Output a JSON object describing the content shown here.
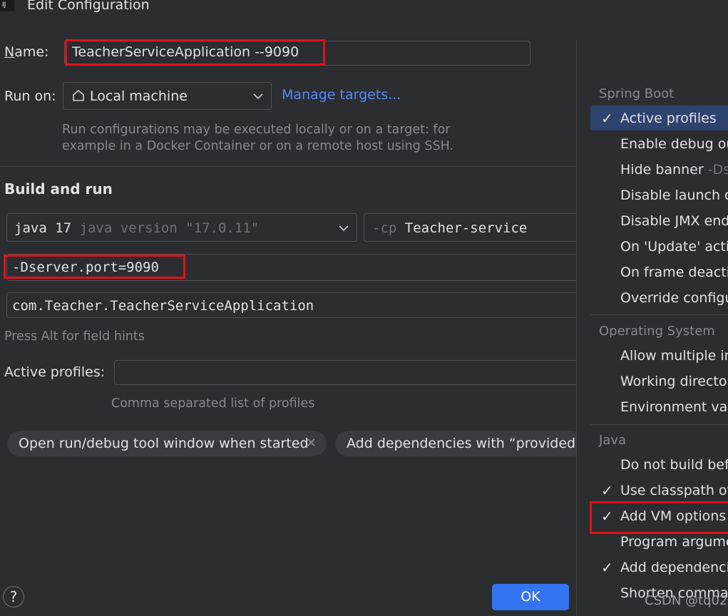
{
  "window": {
    "title": "Edit Configuration"
  },
  "name": {
    "label": "Name:",
    "value": "TeacherServiceApplication --9090"
  },
  "run_on": {
    "label": "Run on:",
    "value": "Local machine",
    "manage_link": "Manage targets...",
    "hint_line1": "Run configurations may be executed locally or on a target: for",
    "hint_line2": "example in a Docker Container or on a remote host using SSH."
  },
  "build": {
    "section_title": "Build and run",
    "jdk_value": "java 17",
    "jdk_version": "java version \"17.0.11\"",
    "cp_prefix": "-cp",
    "cp_value": "Teacher-service",
    "vm_options": "-Dserver.port=9090",
    "main_class": "com.Teacher.TeacherServiceApplication",
    "field_hints": "Press Alt for field hints"
  },
  "profiles": {
    "label": "Active profiles:",
    "value": "",
    "hint": "Comma separated list of profiles"
  },
  "chips": [
    {
      "label": "Open run/debug tool window when started"
    },
    {
      "label": "Add dependencies with “provided”"
    }
  ],
  "popup": {
    "groups": [
      {
        "title": "Spring Boot"
      },
      {
        "title": "Operating System"
      },
      {
        "title": "Java"
      }
    ],
    "items": [
      {
        "label": "Active profiles",
        "checked": true,
        "selected": true
      },
      {
        "label": "Enable debug ou",
        "checked": false
      },
      {
        "label": "Hide banner",
        "suffix": "-Ds",
        "checked": false
      },
      {
        "label": "Disable launch o",
        "checked": false
      },
      {
        "label": "Disable JMX end",
        "checked": false
      },
      {
        "label": "On 'Update' actio",
        "checked": false
      },
      {
        "label": "On frame deactiv",
        "checked": false
      },
      {
        "label": "Override configu",
        "checked": false
      },
      {
        "label": "Allow multiple in",
        "checked": false
      },
      {
        "label": "Working director",
        "checked": false
      },
      {
        "label": "Environment vari",
        "checked": false
      },
      {
        "label": "Do not build befo",
        "checked": false
      },
      {
        "label": "Use classpath of",
        "checked": true
      },
      {
        "label": "Add VM options",
        "checked": true
      },
      {
        "label": "Program argume",
        "checked": false
      },
      {
        "label": "Add dependencie",
        "checked": true
      },
      {
        "label": "Shorten comman",
        "checked": false
      }
    ]
  },
  "buttons": {
    "ok": "OK",
    "help": "?"
  },
  "watermark": "CSDN @tq02",
  "colors": {
    "accent": "#3574f0",
    "highlight": "#e0121b",
    "selection": "#2e436e",
    "link": "#548af7"
  }
}
